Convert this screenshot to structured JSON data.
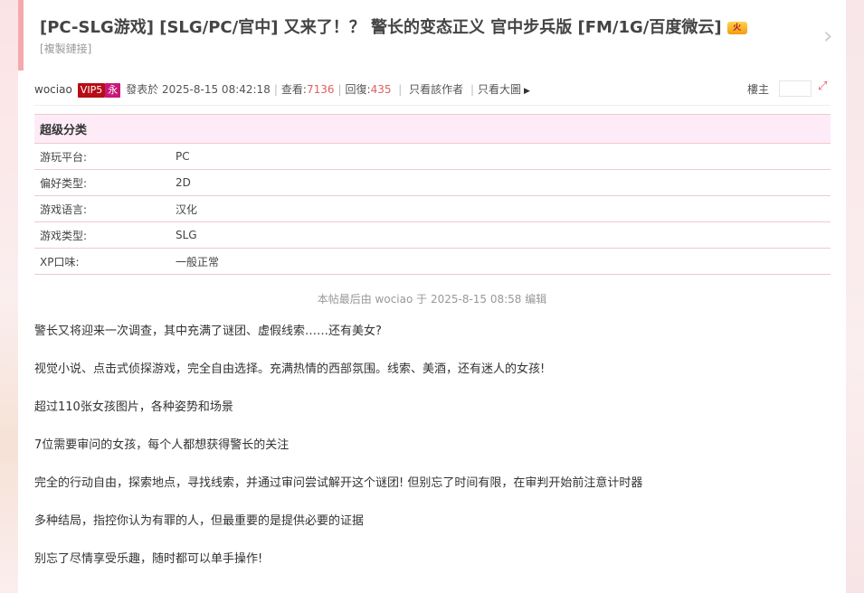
{
  "thread": {
    "title": "[PC-SLG游戏] [SLG/PC/官中] 又来了！？ 警长的变态正义 官中步兵版 [FM/1G/百度微云]",
    "hot_badge": "火",
    "copy_link": "[複製鏈接]"
  },
  "meta": {
    "author": "wociao",
    "vip": "VIP5",
    "yong": "永",
    "posted": "發表於 2025-8-15 08:42:18",
    "views_label": "查看:",
    "views": "7136",
    "replies_label": "回復:",
    "replies": "435",
    "only_author": "只看該作者",
    "big_image": "只看大圖",
    "floor": "樓主"
  },
  "category": {
    "header": "超级分类",
    "rows": [
      {
        "key": "游玩平台:",
        "value": "PC"
      },
      {
        "key": "偏好类型:",
        "value": "2D"
      },
      {
        "key": "游戏语言:",
        "value": "汉化"
      },
      {
        "key": "游戏类型:",
        "value": "SLG"
      },
      {
        "key": "XP口味:",
        "value": "一般正常"
      }
    ]
  },
  "edited_note": "本帖最后由 wociao 于 2025-8-15 08:58 编辑",
  "content": [
    "警长又将迎来一次调查，其中充满了谜团、虚假线索……还有美女?",
    "视觉小说、点击式侦探游戏，完全自由选择。充满热情的西部氛围。线索、美酒，还有迷人的女孩!",
    "超过110张女孩图片，各种姿势和场景",
    "7位需要审问的女孩，每个人都想获得警长的关注",
    "完全的行动自由，探索地点，寻找线索，并通过审问尝试解开这个谜团! 但别忘了时间有限，在审判开始前注意计时器",
    "多种结局，指控你认为有罪的人，但最重要的是提供必要的证据",
    "别忘了尽情享受乐趣，随时都可以单手操作!"
  ],
  "colors": {
    "accent_pink": "#f4a9ad",
    "table_header_bg": "#fdecf7",
    "vip_red": "#b80d14",
    "count_red": "#e06060"
  }
}
